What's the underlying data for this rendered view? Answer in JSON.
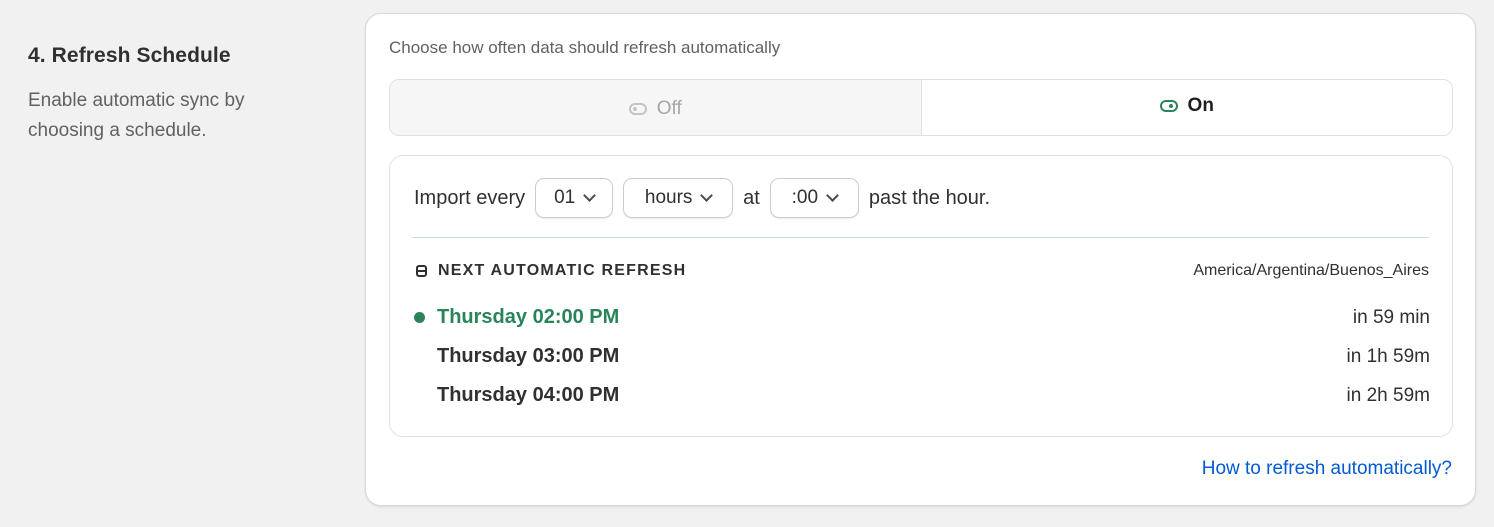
{
  "section": {
    "title": "4. Refresh Schedule",
    "description": "Enable automatic sync by choosing a schedule."
  },
  "card": {
    "prompt": "Choose how often data should refresh automatically",
    "toggle": {
      "off_label": "Off",
      "on_label": "On",
      "selected": "On"
    },
    "import": {
      "prefix": "Import every",
      "interval_value": "01",
      "unit_value": "hours",
      "at_label": "at",
      "minute_value": ":00",
      "suffix": "past the hour."
    },
    "next": {
      "header": "NEXT AUTOMATIC REFRESH",
      "timezone": "America/Argentina/Buenos_Aires",
      "items": [
        {
          "time": "Thursday 02:00 PM",
          "relative": "in 59 min"
        },
        {
          "time": "Thursday 03:00 PM",
          "relative": "in 1h 59m"
        },
        {
          "time": "Thursday 04:00 PM",
          "relative": "in 2h 59m"
        }
      ]
    },
    "help_link": "How to refresh automatically?"
  },
  "icons": {
    "off": "toggle-off-icon",
    "on": "toggle-on-icon",
    "calendar": "calendar-icon",
    "active": "status-dot-icon",
    "chevron": "chevron-down-icon"
  },
  "colors": {
    "accent_green": "#29845a",
    "link_blue": "#005bd3",
    "background": "#f1f1f1"
  }
}
